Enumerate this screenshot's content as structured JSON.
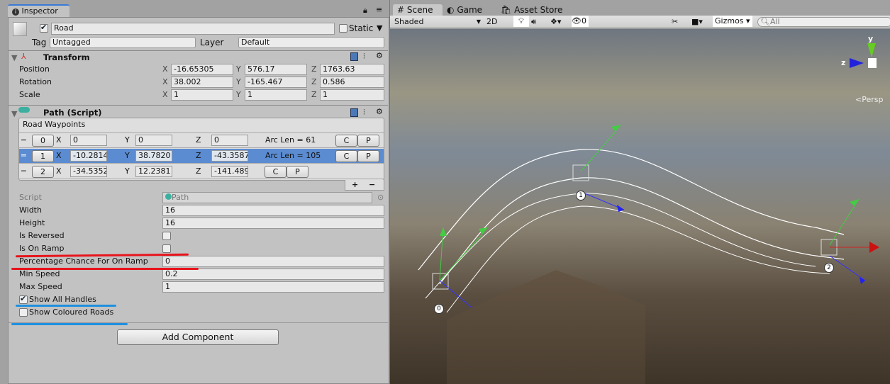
{
  "inspector": {
    "tab": "Inspector",
    "object_name": "Road",
    "active": true,
    "static_label": "Static",
    "static": false,
    "tag_label": "Tag",
    "tag": "Untagged",
    "layer_label": "Layer",
    "layer": "Default"
  },
  "transform": {
    "title": "Transform",
    "rows": [
      {
        "label": "Position",
        "x": "-16.65305",
        "y": "576.17",
        "z": "1763.63"
      },
      {
        "label": "Rotation",
        "x": "38.002",
        "y": "-165.467",
        "z": "0.586"
      },
      {
        "label": "Scale",
        "x": "1",
        "y": "1",
        "z": "1"
      }
    ]
  },
  "axis": {
    "x": "X",
    "y": "Y",
    "z": "Z"
  },
  "path": {
    "title": "Path (Script)",
    "list_title": "Road Waypoints",
    "waypoints": [
      {
        "index": "0",
        "x": "0",
        "y": "0",
        "z": "0",
        "arc": "Arc Len = 61"
      },
      {
        "index": "1",
        "x": "-10.2814",
        "y": "38.7820",
        "z": "-43.3587",
        "arc": "Arc Len = 105"
      },
      {
        "index": "2",
        "x": "-34.5352",
        "y": "12.2381",
        "z": "-141.489",
        "arc": ""
      }
    ],
    "c": "C",
    "p": "P",
    "plus": "+",
    "minus": "−",
    "script_label": "Script",
    "script": "Path",
    "width_label": "Width",
    "width": "16",
    "height_label": "Height",
    "height": "16",
    "reversed_label": "Is Reversed",
    "reversed": false,
    "ramp_label": "Is On Ramp",
    "ramp": false,
    "pct_label": "Percentage Chance For On Ramp",
    "pct": "0",
    "min_label": "Min Speed",
    "min": "0.2",
    "max_label": "Max Speed",
    "max": "1",
    "handles_label": "Show All Handles",
    "handles": true,
    "coloured_label": "Show Coloured Roads",
    "coloured": false
  },
  "add_component": "Add Component",
  "scene": {
    "tabs": [
      "Scene",
      "Game",
      "Asset Store"
    ],
    "shading": "Shaded",
    "mode2d": "2D",
    "hidden_count": "0",
    "gizmos": "Gizmos",
    "search_placeholder": "All",
    "persp": "Persp",
    "axis_y": "y",
    "axis_z": "z",
    "wp_labels": [
      "0",
      "1",
      "2"
    ]
  },
  "colors": {
    "selected_row": "#5b8bd0",
    "annotation_red": "#e8141c",
    "annotation_blue": "#1e90e0"
  }
}
